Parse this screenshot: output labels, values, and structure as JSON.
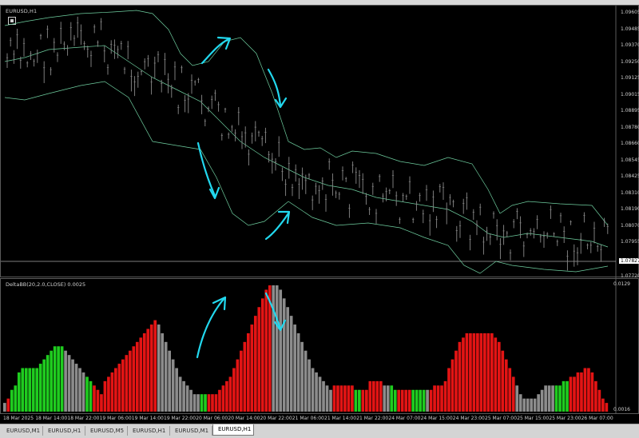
{
  "main_chart": {
    "title": "EURUSD,H1",
    "price_levels": [
      "1.09605",
      "1.09485",
      "1.09370",
      "1.09250",
      "1.09125",
      "1.09015",
      "1.08895",
      "1.08780",
      "1.08660",
      "1.08545",
      "1.08425",
      "1.08310",
      "1.08190",
      "1.08070",
      "1.07955",
      "1.07720"
    ],
    "current_price": "1.07827"
  },
  "indicator": {
    "title": "DeltaBB(20,2.0,CLOSE) 0.0025",
    "scale_top": "0.0129",
    "scale_bottom": "0.0016"
  },
  "time_labels": [
    "18 Mar 2025",
    "18 Mar 14:00",
    "18 Mar 22:00",
    "19 Mar 06:00",
    "19 Mar 14:00",
    "19 Mar 22:00",
    "20 Mar 06:00",
    "20 Mar 14:00",
    "20 Mar 22:00",
    "21 Mar 06:00",
    "21 Mar 14:00",
    "21 Mar 22:00",
    "24 Mar 07:00",
    "24 Mar 15:00",
    "24 Mar 23:00",
    "25 Mar 07:00",
    "25 Mar 15:00",
    "25 Mar 23:00",
    "26 Mar 07:00"
  ],
  "tabs": [
    "EURUSD,M1",
    "EURUSD,H1",
    "EURUSD,M5",
    "EURUSD,H1",
    "EURUSD,M1",
    "EURUSD,H1"
  ],
  "active_tab": 5,
  "colors": {
    "band": "#6fcfa0",
    "candle": "#8a8a8a",
    "arrow": "#22d8ee",
    "bar_red": "#e31414",
    "bar_green": "#1fcc1f",
    "bar_gray": "#8c8c8c"
  },
  "chart_data": {
    "type": "bar",
    "series": [
      {
        "values": [
          2,
          3,
          5,
          6,
          9,
          10,
          10,
          10,
          10,
          10,
          11,
          12,
          13,
          14,
          15,
          15,
          15,
          14,
          13,
          12,
          11,
          10,
          9,
          8,
          7,
          6,
          5,
          4,
          7,
          8,
          9,
          10,
          11,
          12,
          13,
          14,
          15,
          16,
          17,
          18,
          19,
          20,
          21,
          20,
          18,
          16,
          14,
          12,
          10,
          8,
          7,
          6,
          5,
          4,
          4,
          4,
          4,
          4,
          4,
          4,
          5,
          6,
          7,
          8,
          10,
          12,
          14,
          16,
          18,
          20,
          22,
          24,
          26,
          28,
          29,
          29,
          29,
          28,
          26,
          24,
          22,
          20,
          18,
          16,
          14,
          12,
          10,
          9,
          8,
          7,
          6,
          5,
          6,
          6,
          6,
          6,
          6,
          6,
          5,
          5,
          5,
          5,
          7,
          7,
          7,
          7,
          6,
          6,
          6,
          5,
          5,
          5,
          5,
          5,
          5,
          5,
          5,
          5,
          5,
          5,
          6,
          6,
          6,
          7,
          10,
          12,
          14,
          16,
          17,
          18,
          18,
          18,
          18,
          18,
          18,
          18,
          18,
          17,
          16,
          14,
          12,
          10,
          8,
          6,
          4,
          3,
          3,
          3,
          3,
          4,
          5,
          6,
          6,
          6,
          6,
          6,
          7,
          7,
          8,
          8,
          9,
          9,
          10,
          10,
          9,
          7,
          5,
          3,
          2
        ]
      }
    ],
    "colors": [
      "gray",
      "red",
      "green",
      "green",
      "green",
      "green",
      "green",
      "green",
      "green",
      "green",
      "green",
      "green",
      "green",
      "green",
      "green",
      "green",
      "green",
      "gray",
      "gray",
      "gray",
      "gray",
      "gray",
      "gray",
      "green",
      "green",
      "red",
      "red",
      "red",
      "red",
      "red",
      "red",
      "red",
      "red",
      "red",
      "red",
      "red",
      "red",
      "red",
      "red",
      "red",
      "red",
      "red",
      "red",
      "gray",
      "gray",
      "gray",
      "gray",
      "gray",
      "gray",
      "gray",
      "gray",
      "gray",
      "gray",
      "gray",
      "gray",
      "green",
      "green",
      "red",
      "red",
      "red",
      "red",
      "red",
      "red",
      "red",
      "red",
      "red",
      "red",
      "red",
      "red",
      "red",
      "red",
      "red",
      "red",
      "red",
      "red",
      "gray",
      "gray",
      "gray",
      "gray",
      "gray",
      "gray",
      "gray",
      "gray",
      "gray",
      "gray",
      "gray",
      "gray",
      "gray",
      "gray",
      "gray",
      "gray",
      "gray",
      "red",
      "red",
      "red",
      "red",
      "red",
      "red",
      "green",
      "green",
      "red",
      "red",
      "red",
      "red",
      "red",
      "red",
      "gray",
      "gray",
      "green",
      "green",
      "red",
      "red",
      "red",
      "red",
      "green",
      "green",
      "green",
      "green",
      "gray",
      "red",
      "red",
      "red",
      "red",
      "red",
      "red",
      "red",
      "red",
      "red",
      "red",
      "red",
      "red",
      "red",
      "red",
      "red",
      "red",
      "red",
      "red",
      "red",
      "red",
      "red",
      "red",
      "red",
      "red",
      "gray",
      "gray",
      "gray",
      "gray",
      "gray",
      "gray",
      "gray",
      "gray",
      "gray",
      "gray",
      "gray",
      "green",
      "green",
      "green",
      "green",
      "red",
      "red",
      "red",
      "red",
      "red",
      "red",
      "red",
      "red",
      "red",
      "red",
      "red",
      "gray",
      "gray",
      "gray",
      "gray",
      "gray"
    ]
  }
}
